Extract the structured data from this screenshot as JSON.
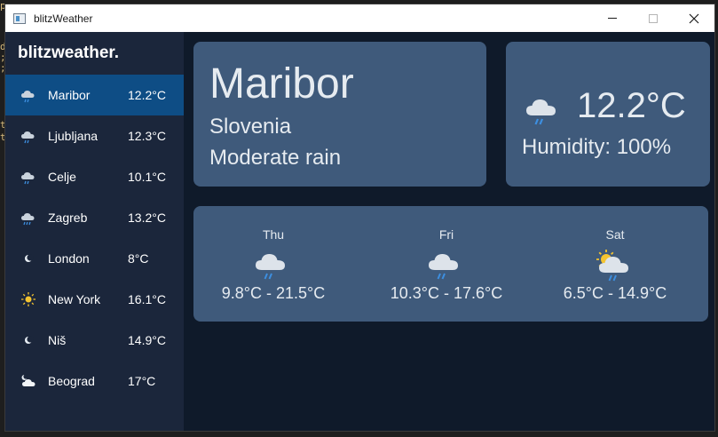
{
  "window": {
    "title": "blitzWeather",
    "minimize_label": "minimize",
    "maximize_label": "maximize",
    "close_label": "close"
  },
  "sidebar": {
    "brand": "blitzweather.",
    "cities": [
      {
        "name": "Maribor",
        "temp": "12.2°C",
        "icon": "rain-cloud-icon",
        "selected": true
      },
      {
        "name": "Ljubljana",
        "temp": "12.3°C",
        "icon": "rain-cloud-icon",
        "selected": false
      },
      {
        "name": "Celje",
        "temp": "10.1°C",
        "icon": "rain-cloud-icon",
        "selected": false
      },
      {
        "name": "Zagreb",
        "temp": "13.2°C",
        "icon": "rain-cloud-icon",
        "selected": false
      },
      {
        "name": "London",
        "temp": "8°C",
        "icon": "crescent-moon-icon",
        "selected": false
      },
      {
        "name": "New York",
        "temp": "16.1°C",
        "icon": "sun-icon",
        "selected": false
      },
      {
        "name": "Niš",
        "temp": "14.9°C",
        "icon": "crescent-moon-icon",
        "selected": false
      },
      {
        "name": "Beograd",
        "temp": "17°C",
        "icon": "moon-cloud-icon",
        "selected": false
      }
    ]
  },
  "location": {
    "city": "Maribor",
    "country": "Slovenia",
    "condition": "Moderate rain"
  },
  "current": {
    "temp": "12.2°C",
    "humidity": "Humidity: 100%",
    "icon": "rain-cloud-icon"
  },
  "forecast": [
    {
      "day": "Thu",
      "range": "9.8°C - 21.5°C",
      "icon": "rain-cloud-icon"
    },
    {
      "day": "Fri",
      "range": "10.3°C - 17.6°C",
      "icon": "rain-cloud-icon"
    },
    {
      "day": "Sat",
      "range": "6.5°C - 14.9°C",
      "icon": "sun-rain-cloud-icon"
    }
  ],
  "colors": {
    "sidebar_bg": "#1b263b",
    "main_bg": "#0f1a2a",
    "card_bg": "#3f5a7b",
    "selected_bg": "#0e4d85",
    "rain_blue": "#3d8fe0",
    "sun_yellow": "#f4c430"
  }
}
